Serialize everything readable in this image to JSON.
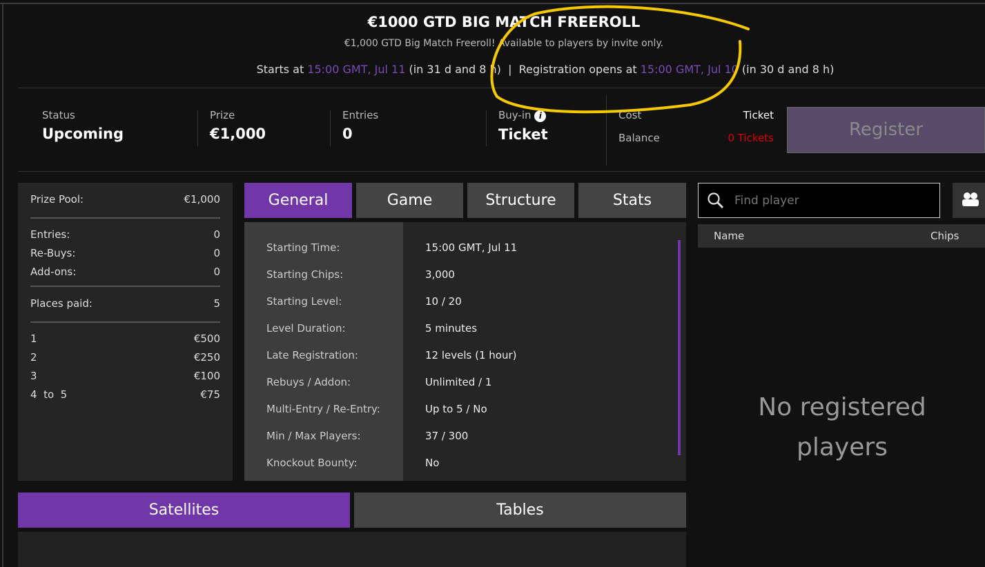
{
  "header": {
    "title": "€1000 GTD BIG MATCH FREEROLL",
    "subtitle": "€1,000 GTD Big Match Freeroll! Available to players by invite only.",
    "starts_prefix": "Starts at ",
    "starts_time": "15:00 GMT, Jul 11",
    "starts_suffix": " (in 31 d and 8 h)",
    "divider": "|",
    "reg_prefix": "Registration opens at ",
    "reg_time": "15:00 GMT, Jul 10",
    "reg_suffix": " (in 30 d and 8 h)"
  },
  "stats": {
    "status_label": "Status",
    "status_value": "Upcoming",
    "prize_label": "Prize",
    "prize_value": "€1,000",
    "entries_label": "Entries",
    "entries_value": "0",
    "buyin_label": "Buy-in",
    "buyin_value": "Ticket",
    "info_icon": "i",
    "cost_label": "Cost",
    "cost_value": "Ticket",
    "balance_label": "Balance",
    "balance_value": "0 Tickets",
    "register_label": "Register"
  },
  "colors": {
    "accent": "#7137a9",
    "time": "#7a4ab8",
    "balance": "#e00000",
    "annotation": "#f5c800"
  },
  "summary": {
    "prize_pool_label": "Prize Pool:",
    "prize_pool_value": "€1,000",
    "counts": [
      {
        "label": "Entries:",
        "value": "0"
      },
      {
        "label": "Re-Buys:",
        "value": "0"
      },
      {
        "label": "Add-ons:",
        "value": "0"
      }
    ],
    "places_label": "Places paid:",
    "places_value": "5",
    "payouts": [
      {
        "place": "1",
        "amount": "€500"
      },
      {
        "place": "2",
        "amount": "€250"
      },
      {
        "place": "3",
        "amount": "€100"
      },
      {
        "place": "4  to  5",
        "amount": "€75"
      }
    ]
  },
  "tabs": [
    {
      "label": "General"
    },
    {
      "label": "Game"
    },
    {
      "label": "Structure"
    },
    {
      "label": "Stats"
    }
  ],
  "details": [
    {
      "label": "Starting Time:",
      "value": "15:00 GMT, Jul 11"
    },
    {
      "label": "Starting Chips:",
      "value": "3,000"
    },
    {
      "label": "Starting Level:",
      "value": "10 / 20"
    },
    {
      "label": "Level Duration:",
      "value": "5 minutes"
    },
    {
      "label": "Late Registration:",
      "value": "12 levels (1 hour)"
    },
    {
      "label": "Rebuys / Addon:",
      "value": "Unlimited / 1"
    },
    {
      "label": "Multi-Entry / Re-Entry:",
      "value": "Up to 5 / No"
    },
    {
      "label": "Min / Max Players:",
      "value": "37 / 300"
    },
    {
      "label": "Knockout Bounty:",
      "value": "No"
    }
  ],
  "players": {
    "search_placeholder": "Find player",
    "col_name": "Name",
    "col_chips": "Chips",
    "empty_message": "No registered players"
  },
  "bottom_tabs": [
    {
      "label": "Satellites"
    },
    {
      "label": "Tables"
    }
  ]
}
